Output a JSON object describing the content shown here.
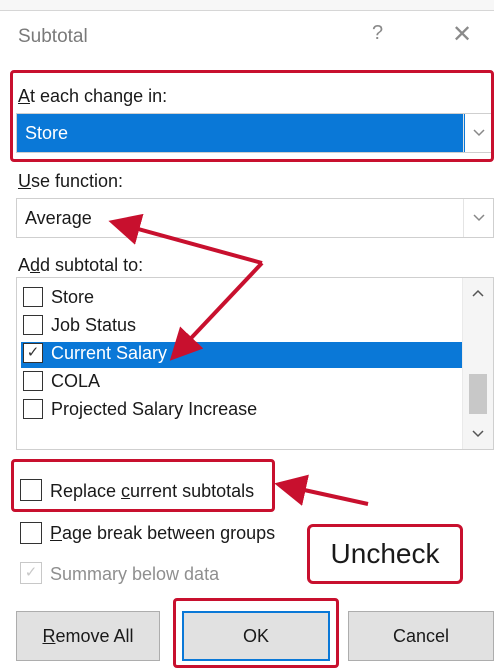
{
  "dialog": {
    "title": "Subtotal",
    "help": "?",
    "close": "✕"
  },
  "at_each_change": {
    "label_ul": "A",
    "label_rest": "t each change in:",
    "value": "Store"
  },
  "use_function": {
    "label_ul": "U",
    "label_rest": "se function:",
    "value": "Average"
  },
  "add_subtotal": {
    "label_pre": "A",
    "label_ul": "d",
    "label_rest": "d subtotal to:",
    "items": [
      {
        "label": "Store",
        "checked": false
      },
      {
        "label": "Job Status",
        "checked": false
      },
      {
        "label": "Current Salary",
        "checked": true
      },
      {
        "label": "COLA",
        "checked": false
      },
      {
        "label": "Projected Salary Increase",
        "checked": false
      }
    ]
  },
  "options": {
    "replace_pre": "Replace ",
    "replace_ul": "c",
    "replace_rest": "urrent subtotals",
    "replace_checked": false,
    "pagebreak_ul": "P",
    "pagebreak_rest": "age break between groups",
    "pagebreak_checked": false,
    "summary_label": "Summary below data",
    "summary_checked": true
  },
  "buttons": {
    "remove_ul": "R",
    "remove_rest": "emove All",
    "ok": "OK",
    "cancel": "Cancel"
  },
  "annotation": {
    "callout": "Uncheck",
    "highlight_color": "#c8102e"
  },
  "icons": {
    "dropdown": "chevron-down",
    "scroll_up": "chevron-up",
    "scroll_down": "chevron-down",
    "check": "checkmark"
  },
  "colors": {
    "selection": "#0a78d7",
    "button_face": "#e1e1e1"
  }
}
